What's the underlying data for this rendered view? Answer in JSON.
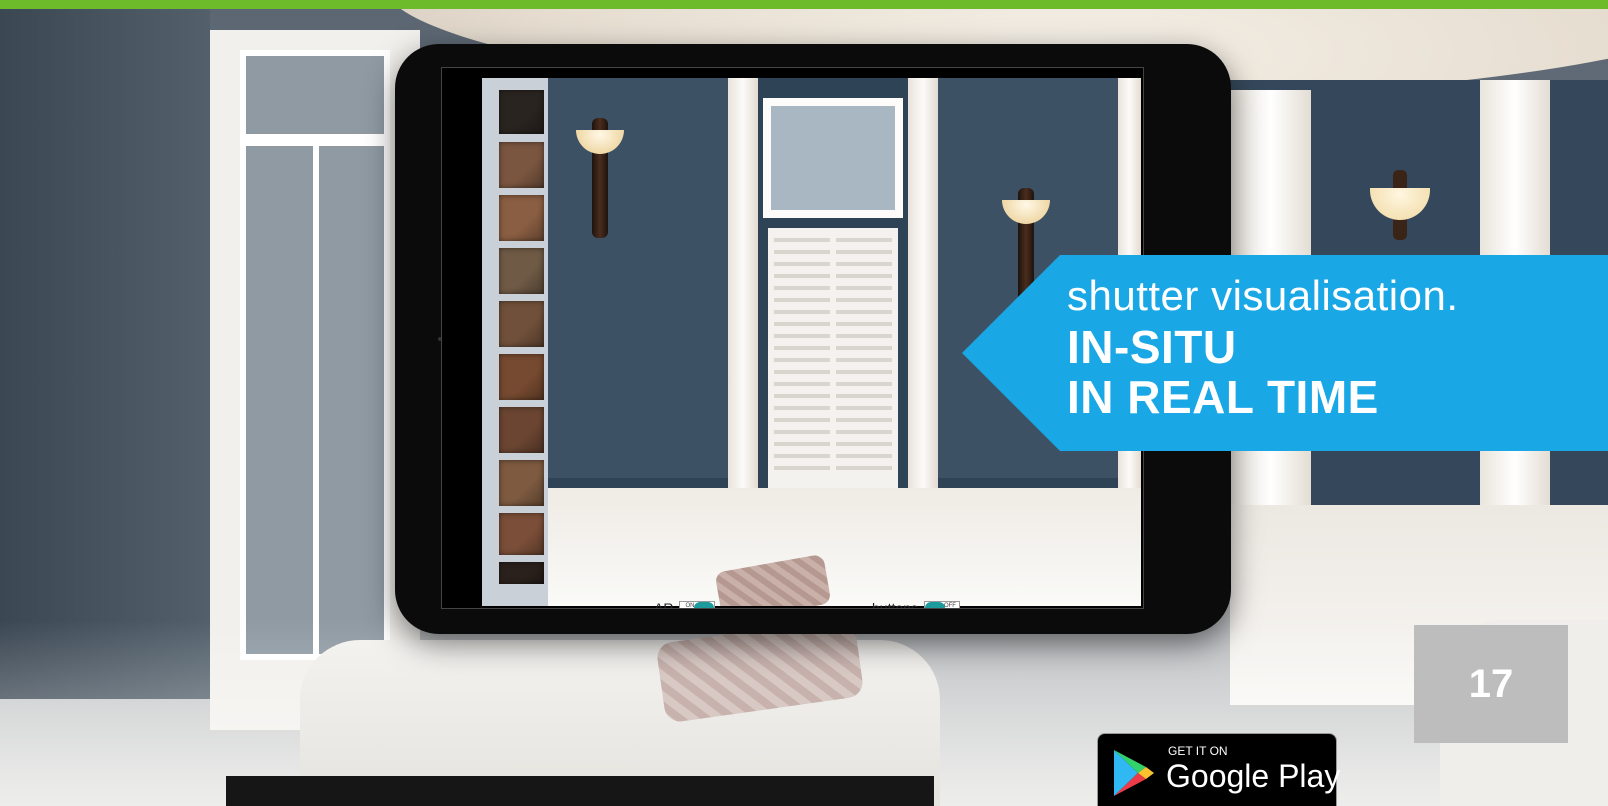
{
  "tablet": {
    "toggles": [
      {
        "label": "AR",
        "state_text": "ON",
        "on": true
      },
      {
        "label": "buttons",
        "state_text": "OFF",
        "on": false
      }
    ],
    "swatch_colors": [
      "#2a2420",
      "#7a5640",
      "#8a5e42",
      "#6f5a45",
      "#70503a",
      "#764a30",
      "#6b4532",
      "#7d5a40",
      "#7a4e38",
      "#2b211c"
    ]
  },
  "callout": {
    "line1": "shutter visualisation.",
    "line2": "IN-SITU",
    "line3": "IN REAL TIME",
    "color": "#1aa7e6"
  },
  "page": {
    "number": "17",
    "accent_color": "#6dbb2a"
  },
  "store_badge": {
    "small_text": "GET IT ON",
    "big_text": "Google Play",
    "icon": "google-play-icon"
  }
}
